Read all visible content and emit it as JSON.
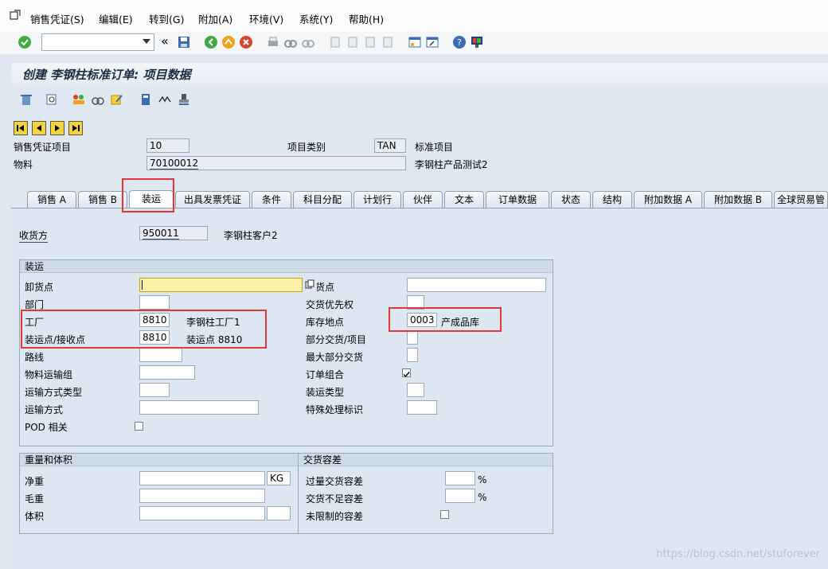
{
  "menu": {
    "items": [
      "销售凭证(S)",
      "编辑(E)",
      "转到(G)",
      "附加(A)",
      "环境(V)",
      "系统(Y)",
      "帮助(H)"
    ]
  },
  "title": "创建 李钢柱标准订单: 项目数据",
  "header": {
    "item_label": "销售凭证项目",
    "item_value": "10",
    "cat_label": "项目类别",
    "cat_value": "TAN",
    "cat_desc": "标准项目",
    "mat_label": "物料",
    "mat_value": "70100012",
    "mat_desc": "李钢柱产品测试2"
  },
  "tabs": [
    "销售 A",
    "销售 B",
    "装运",
    "出具发票凭证",
    "条件",
    "科目分配",
    "计划行",
    "伙伴",
    "文本",
    "订单数据",
    "状态",
    "结构",
    "附加数据 A",
    "附加数据 B",
    "全球贸易管"
  ],
  "ship_to": {
    "label": "收货方",
    "value": "950011",
    "desc": "李钢柱客户2"
  },
  "shipping": {
    "title": "装运",
    "unload_label": "卸货点",
    "unload_value": "",
    "dept_label": "部门",
    "plant_label": "工厂",
    "plant_value": "8810",
    "plant_desc": "李钢柱工厂1",
    "shippoint_label": "装运点/接收点",
    "shippoint_value": "8810",
    "shippoint_desc": "装运点 8810",
    "route_label": "路线",
    "mat_freight_label": "物料运输组",
    "transport_type_label": "运输方式类型",
    "transport_label": "运输方式",
    "pod_label": "POD 相关",
    "recv_label": "收货点",
    "priority_label": "交货优先权",
    "storage_label": "库存地点",
    "storage_value": "0003",
    "storage_desc": "产成品库",
    "partial_label": "部分交货/项目",
    "maxpartial_label": "最大部分交货",
    "combine_label": "订单组合",
    "combine_checked": true,
    "shiptype_label": "装运类型",
    "special_label": "特殊处理标识"
  },
  "weight": {
    "title": "重量和体积",
    "net_label": "净重",
    "unit": "KG",
    "gross_label": "毛重",
    "volume_label": "体积"
  },
  "tolerance": {
    "title": "交货容差",
    "over_label": "过量交货容差",
    "under_label": "交货不足容差",
    "unlimited_label": "未限制的容差",
    "pct": "%"
  },
  "watermark": "https://blog.csdn.net/stuforever"
}
